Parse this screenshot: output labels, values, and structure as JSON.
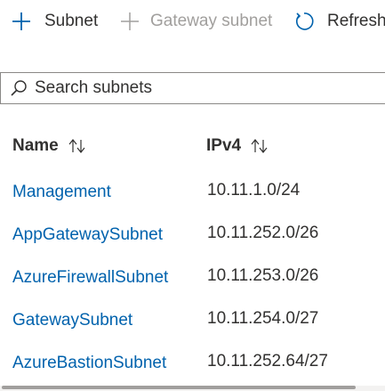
{
  "toolbar": {
    "add_subnet": {
      "label": "Subnet",
      "icon": "plus-icon"
    },
    "add_gateway_subnet": {
      "label": "Gateway subnet",
      "icon": "plus-icon",
      "disabled": true
    },
    "refresh": {
      "label": "Refresh",
      "icon": "refresh-icon"
    }
  },
  "search": {
    "placeholder": "Search subnets",
    "value": "",
    "icon": "search-icon"
  },
  "table": {
    "columns": [
      {
        "label": "Name",
        "sort_icon": "sort-arrows-icon"
      },
      {
        "label": "IPv4",
        "sort_icon": "sort-arrows-icon"
      }
    ],
    "rows": [
      {
        "name": "Management",
        "ipv4": "10.11.1.0/24"
      },
      {
        "name": "AppGatewaySubnet",
        "ipv4": "10.11.252.0/26"
      },
      {
        "name": "AzureFirewallSubnet",
        "ipv4": "10.11.253.0/26"
      },
      {
        "name": "GatewaySubnet",
        "ipv4": "10.11.254.0/27"
      },
      {
        "name": "AzureBastionSubnet",
        "ipv4": "10.11.252.64/27"
      }
    ]
  },
  "colors": {
    "link": "#0062ad",
    "text": "#323130",
    "disabled": "#a19f9d",
    "border": "#8a8886"
  }
}
